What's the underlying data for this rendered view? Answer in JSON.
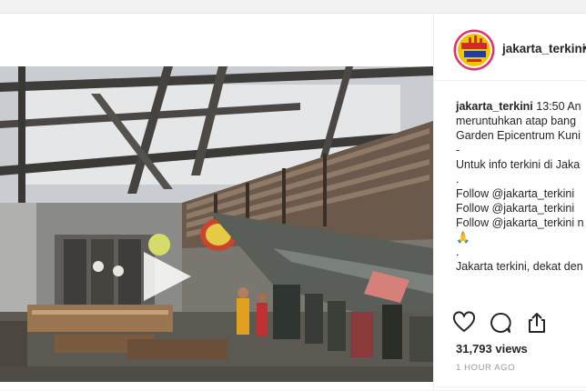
{
  "header": {
    "username": "jakarta_terkini",
    "more": "•"
  },
  "caption": {
    "lines": [
      {
        "user": "jakarta_terkini",
        "text": " 13:50 An"
      },
      {
        "text": "meruntuhkan atap bang"
      },
      {
        "text": "Garden Epicentrum Kuni"
      },
      {
        "text": "-"
      },
      {
        "text": "Untuk info terkini di Jaka"
      },
      {
        "text": "."
      },
      {
        "text": "Follow @jakarta_terkini"
      },
      {
        "text": "Follow @jakarta_terkini"
      },
      {
        "text": "Follow @jakarta_terkini n"
      },
      {
        "text": "🙏"
      },
      {
        "text": "."
      },
      {
        "text": "Jakarta terkini, dekat den"
      }
    ]
  },
  "stats": {
    "views": "31,793 views",
    "time": "1 HOUR AGO"
  },
  "icons": {
    "like": "heart-icon",
    "comment": "comment-icon",
    "share": "share-icon",
    "play": "play-icon",
    "avatar": "jakarta-terkini-logo"
  },
  "colors": {
    "background": "#f2f2f2",
    "panel": "#ffffff",
    "text": "#262626",
    "muted": "#999999",
    "avatar_ring": "#e0326e",
    "avatar_fill": "#f4c400"
  },
  "media": {
    "type": "video",
    "state": "paused"
  }
}
